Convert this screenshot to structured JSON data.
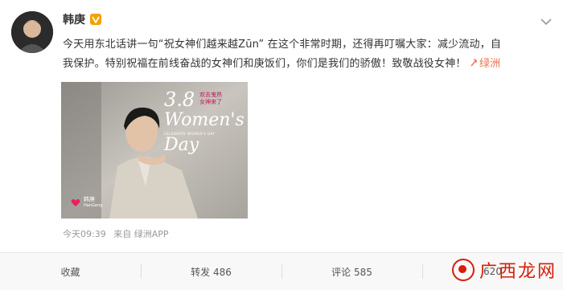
{
  "post": {
    "author": "韩庚",
    "text_line1": "今天用东北话讲一句“祝女神们越来越Zūn” 在这个非常时期，还得再叮嘱大家：减少流动，自",
    "text_line2": "我保护。特别祝福在前线奋战的女神们和庚饭们，你们是我们的骄傲！致敬战役女神！",
    "location": "绿洲",
    "time": "今天09:39",
    "source": "来自 绿洲APP"
  },
  "image": {
    "title_num": "3.8",
    "title_line1": "Women's",
    "title_line2": "Day",
    "stamp": "欢去鬼热 女神来了",
    "tagline": "CELEBRATE WOMEN'S DAY",
    "caption_name": "韩庚",
    "caption_sub": "HanGeng"
  },
  "actions": {
    "favorite": "收藏",
    "repost": "转发 486",
    "comment": "评论 585",
    "like": "620"
  },
  "watermark": {
    "text": "广西龙网"
  },
  "colors": {
    "accent": "#eb7350",
    "badge": "#f3a000",
    "watermark": "#d81e06"
  }
}
